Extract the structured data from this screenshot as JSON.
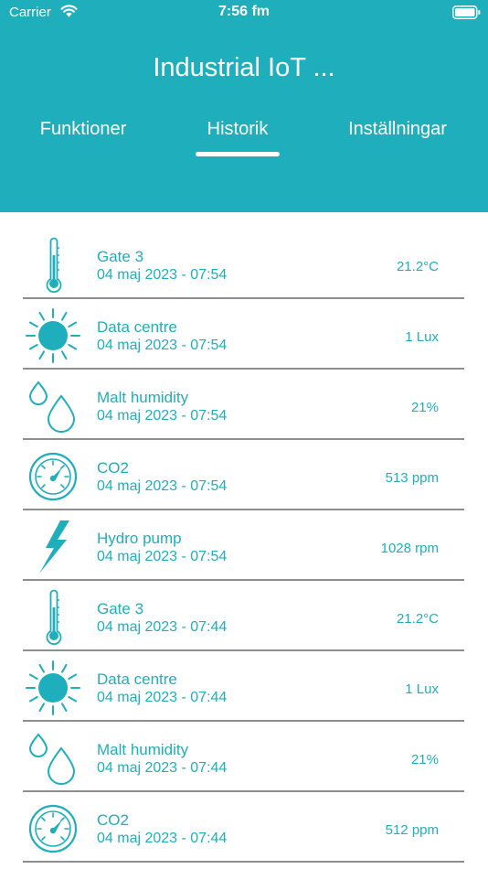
{
  "status_bar": {
    "carrier": "Carrier",
    "time": "7:56 fm"
  },
  "app": {
    "title": "Industrial IoT ..."
  },
  "tabs": [
    {
      "label": "Funktioner"
    },
    {
      "label": "Historik"
    },
    {
      "label": "Inställningar"
    }
  ],
  "active_tab": "Historik",
  "colors": {
    "accent": "#1fafbc",
    "divider": "#8e8e8e"
  },
  "history": [
    {
      "icon": "thermometer-icon",
      "name": "Gate 3",
      "time": "04 maj 2023 - 07:54",
      "value": "21.2°C"
    },
    {
      "icon": "sun-icon",
      "name": "Data centre",
      "time": "04 maj 2023 - 07:54",
      "value": "1 Lux"
    },
    {
      "icon": "water-drops-icon",
      "name": "Malt humidity",
      "time": "04 maj 2023 - 07:54",
      "value": "21%"
    },
    {
      "icon": "gauge-icon",
      "name": "CO2",
      "time": "04 maj 2023 - 07:54",
      "value": "513 ppm"
    },
    {
      "icon": "lightning-icon",
      "name": "Hydro pump",
      "time": "04 maj 2023 - 07:54",
      "value": "1028 rpm"
    },
    {
      "icon": "thermometer-icon",
      "name": "Gate 3",
      "time": "04 maj 2023 - 07:44",
      "value": "21.2°C"
    },
    {
      "icon": "sun-icon",
      "name": "Data centre",
      "time": "04 maj 2023 - 07:44",
      "value": "1 Lux"
    },
    {
      "icon": "water-drops-icon",
      "name": "Malt humidity",
      "time": "04 maj 2023 - 07:44",
      "value": "21%"
    },
    {
      "icon": "gauge-icon",
      "name": "CO2",
      "time": "04 maj 2023 - 07:44",
      "value": "512 ppm"
    }
  ]
}
